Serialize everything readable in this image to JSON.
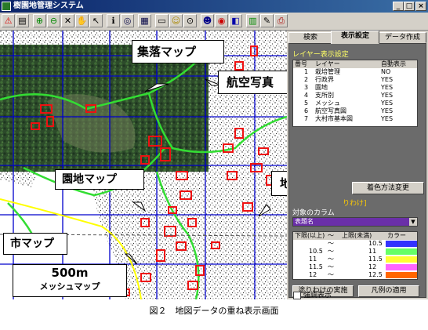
{
  "window": {
    "title": "樹園地管理システム"
  },
  "tabs": [
    "検索",
    "表示設定",
    "データ作成"
  ],
  "layer_settings": {
    "section_title": "レイヤー表示設定",
    "columns": [
      "番号",
      "レイヤー",
      "自動表示"
    ],
    "rows": [
      {
        "no": "1",
        "name": "栽培管理",
        "auto": "NO"
      },
      {
        "no": "2",
        "name": "行政界",
        "auto": "YES"
      },
      {
        "no": "3",
        "name": "園地",
        "auto": "YES"
      },
      {
        "no": "4",
        "name": "支所別",
        "auto": "YES"
      },
      {
        "no": "5",
        "name": "メッシュ",
        "auto": "YES"
      },
      {
        "no": "6",
        "name": "航空写真図",
        "auto": "YES"
      },
      {
        "no": "7",
        "name": "大村市基本図",
        "auto": "YES"
      }
    ]
  },
  "color_method_button": "着色方法変更",
  "partial_label": "りわけ]",
  "target_column": {
    "label": "対象のカラム",
    "value": "表題名"
  },
  "color_table": {
    "columns": [
      "下限(以上)",
      "〜",
      "上限(未満)",
      "カラー"
    ],
    "rows": [
      {
        "low": "",
        "sep": "〜",
        "high": "10.5",
        "color": "#3333ff"
      },
      {
        "low": "10.5",
        "sep": "〜",
        "high": "11",
        "color": "#66ff66"
      },
      {
        "low": "11",
        "sep": "〜",
        "high": "11.5",
        "color": "#ffff33"
      },
      {
        "low": "11.5",
        "sep": "〜",
        "high": "12",
        "color": "#ff66ff"
      },
      {
        "low": "12",
        "sep": "〜",
        "high": "12.5",
        "color": "#ff6600"
      }
    ]
  },
  "buttons": {
    "apply_color": "塗りわけの実施",
    "apply_legend": "凡例の適用"
  },
  "checkbox": {
    "label": "強調表示"
  },
  "callouts": {
    "village_map": "集落マップ",
    "aerial_photo": "航空写真",
    "orchard_map": "園地マップ",
    "terrain_map": "地形図",
    "city_map": "市マップ",
    "mesh_map_line1": "500m",
    "mesh_map_line2": "メッシュマップ"
  },
  "caption": "図２　地図データの重ね表示画面"
}
